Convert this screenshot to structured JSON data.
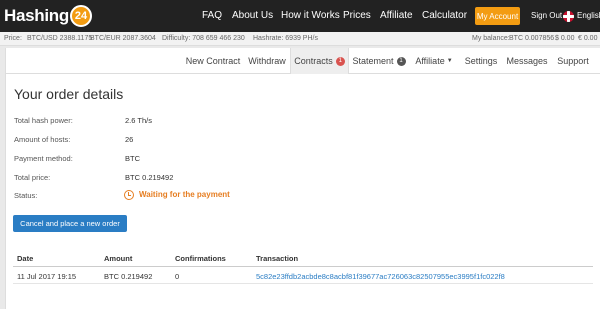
{
  "brand": {
    "name": "Hashing",
    "badge": "24"
  },
  "nav": {
    "links": [
      "FAQ",
      "About Us",
      "How it Works",
      "Prices",
      "Affiliate",
      "Calculator"
    ],
    "account_button": "My Account",
    "sign_out": "Sign Out",
    "language": "English"
  },
  "stats": {
    "price_label": "Price:",
    "btc_usd": "BTC/USD 2388.1175",
    "btc_eur": "BTC/EUR 2087.3604",
    "difficulty": "Difficulty: 708 659 466 230",
    "hashrate": "Hashrate: 6939 PH/s",
    "balance_label": "My balance:",
    "balance_btc": "BTC 0.007856",
    "balance_usd": "$ 0.00",
    "balance_eur": "€ 0.00"
  },
  "subnav": {
    "tabs": [
      {
        "label": "New Contract"
      },
      {
        "label": "Withdraw"
      },
      {
        "label": "Contracts",
        "badge": "1",
        "badge_color": "#d9534f"
      },
      {
        "label": "Statement",
        "badge": "1",
        "badge_color": "#555555"
      },
      {
        "label": "Affiliate"
      },
      {
        "label": "Settings"
      },
      {
        "label": "Messages"
      },
      {
        "label": "Support"
      }
    ]
  },
  "order": {
    "title": "Your order details",
    "rows": [
      {
        "label": "Total hash power:",
        "value": "2.6 Th/s"
      },
      {
        "label": "Amount of hosts:",
        "value": "26"
      },
      {
        "label": "Payment method:",
        "value": "BTC"
      },
      {
        "label": "Total price:",
        "value": "BTC 0.219492"
      },
      {
        "label": "Status:",
        "value": "Waiting for the payment"
      }
    ],
    "status_color": "#e67e22",
    "cancel_button": "Cancel and place a new order"
  },
  "transactions": {
    "headers": [
      "Date",
      "Amount",
      "Confirmations",
      "Transaction"
    ],
    "rows": [
      {
        "date": "11 Jul 2017 19:15",
        "amount": "BTC 0.219492",
        "confirmations": "0",
        "transaction": "5c82e23ffdb2acbde8c8acbf81f39677ac726063c82507955ec3995f1fc022f8"
      }
    ]
  },
  "colors": {
    "accent_orange": "#f39c12",
    "link_blue": "#2a7dc4",
    "topbar": "#222222"
  }
}
